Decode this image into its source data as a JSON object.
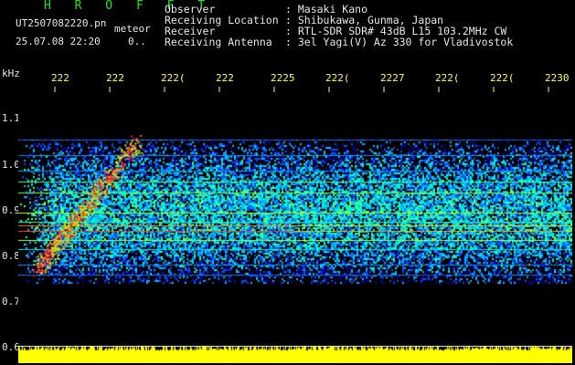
{
  "header": {
    "title": "H R O F F T",
    "filename": "UT2507082220.pn",
    "category": "meteor",
    "datetime": "25.07.08 22:20",
    "dots": "0..",
    "fields": [
      {
        "label": "Observer",
        "value": ": Masaki Kano"
      },
      {
        "label": "Receiving Location",
        "value": ": Shibukawa, Gunma, Japan"
      },
      {
        "label": "Receiver",
        "value": ": RTL-SDR SDR# 43dB L15 103.2MHz CW"
      },
      {
        "label": "Receiving Antenna",
        "value": ": 3el Yagi(V) Az 330 for Vladivostok"
      }
    ]
  },
  "axes": {
    "y_unit": "kHz",
    "y_ticks": [
      "1.1",
      "1.0",
      "0.9",
      "0.8",
      "0.7",
      "0.6"
    ],
    "x_ticks": [
      "222",
      "222",
      "222(",
      "222",
      "2225",
      "222(",
      "2227",
      "222(",
      "222(",
      "2230"
    ]
  },
  "colors": {
    "title": "#19e619",
    "text": "#e6e6e6",
    "time_labels": "#ffff33",
    "signal_strip": "#ffff00",
    "background": "#000000"
  }
}
